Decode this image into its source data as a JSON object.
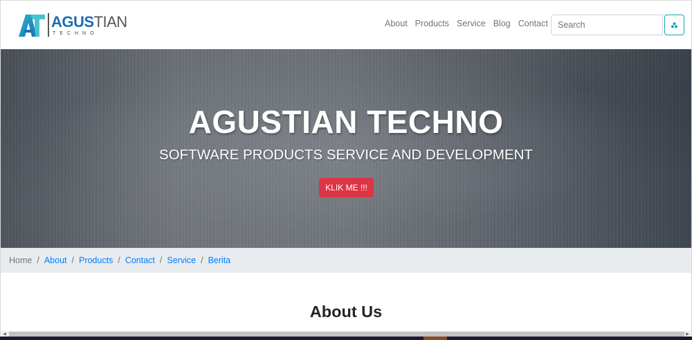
{
  "brand": {
    "name_part1": "AGUS",
    "name_part2": "TIAN",
    "subtitle": "TECHNO",
    "logo_icon": "at-logo-icon",
    "colors": {
      "blue": "#1a6db3",
      "teal": "#2bb7c9"
    }
  },
  "nav": {
    "links": [
      "About",
      "Products",
      "Service",
      "Blog",
      "Contact"
    ]
  },
  "search": {
    "placeholder": "Search",
    "button_icon": "search-icon",
    "button_color": "#17a2b8"
  },
  "hero": {
    "title": "AGUSTIAN TECHNO",
    "subtitle": "SOFTWARE PRODUCTS SERVICE AND DEVELOPMENT",
    "button_label": "KLIK ME !!!",
    "button_color": "#dc3545"
  },
  "breadcrumb": {
    "items": [
      "Home",
      "About",
      "Products",
      "Contact",
      "Service",
      "Berita"
    ],
    "separator": "/",
    "link_color": "#007bff"
  },
  "about": {
    "title": "About Us"
  }
}
